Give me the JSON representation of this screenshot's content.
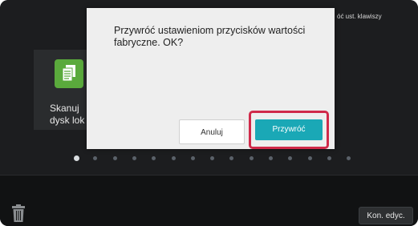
{
  "top_right_label": "óć ust. klawiszy",
  "tile": {
    "label_line1": "Skanuj",
    "label_line2": "dysk lok",
    "icon": "scan-document-icon"
  },
  "pagination": {
    "count": 15,
    "active_index": 0
  },
  "bottom_bar": {
    "trash_icon": "trash-icon",
    "finish_edit_label": "Kon. edyc."
  },
  "dialog": {
    "message": "Przywróć ustawieniom przycisków wartości fabryczne. OK?",
    "cancel_label": "Anuluj",
    "restore_label": "Przywróć",
    "highlight_color": "#d02a4a",
    "restore_color": "#1aa8b6"
  }
}
